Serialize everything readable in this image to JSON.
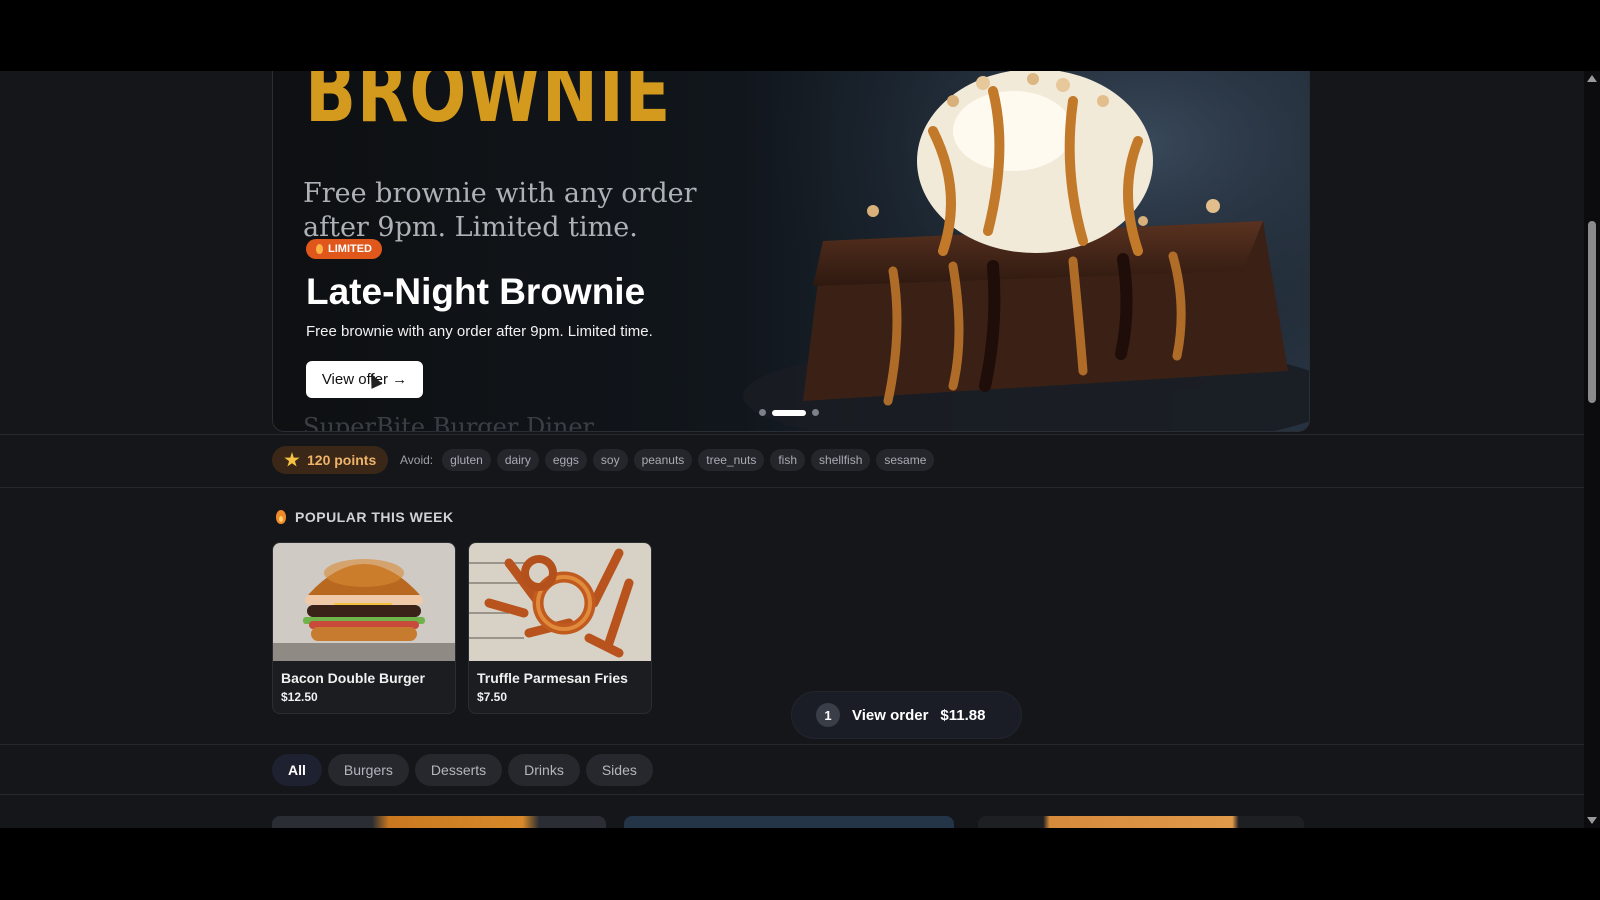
{
  "hero": {
    "bg_title": "BROWNIE",
    "bg_subtitle": "Free brownie with any order after 9pm. Limited time.",
    "bg_footer": "SuperBite Burger Diner",
    "badge": "LIMITED",
    "title": "Late-Night Brownie",
    "description": "Free brownie with any order after 9pm. Limited time.",
    "cta_label": "View offer →",
    "carousel": {
      "slides": 3,
      "active_index": 1
    }
  },
  "loyalty": {
    "points_label": "120 points"
  },
  "allergens": {
    "label": "Avoid:",
    "items": [
      "gluten",
      "dairy",
      "eggs",
      "soy",
      "peanuts",
      "tree_nuts",
      "fish",
      "shellfish",
      "sesame"
    ]
  },
  "popular": {
    "heading": "POPULAR THIS WEEK",
    "items": [
      {
        "name": "Bacon Double Burger",
        "price": "$12.50",
        "image": "burger"
      },
      {
        "name": "Truffle Parmesan Fries",
        "price": "$7.50",
        "image": "fries"
      }
    ]
  },
  "categories": {
    "tabs": [
      "All",
      "Burgers",
      "Desserts",
      "Drinks",
      "Sides"
    ],
    "active": "All"
  },
  "order": {
    "count": "1",
    "label": "View order",
    "total": "$11.88"
  },
  "colors": {
    "accent": "#d49a1e",
    "limited_badge": "#e0571b",
    "background": "#15161a"
  }
}
